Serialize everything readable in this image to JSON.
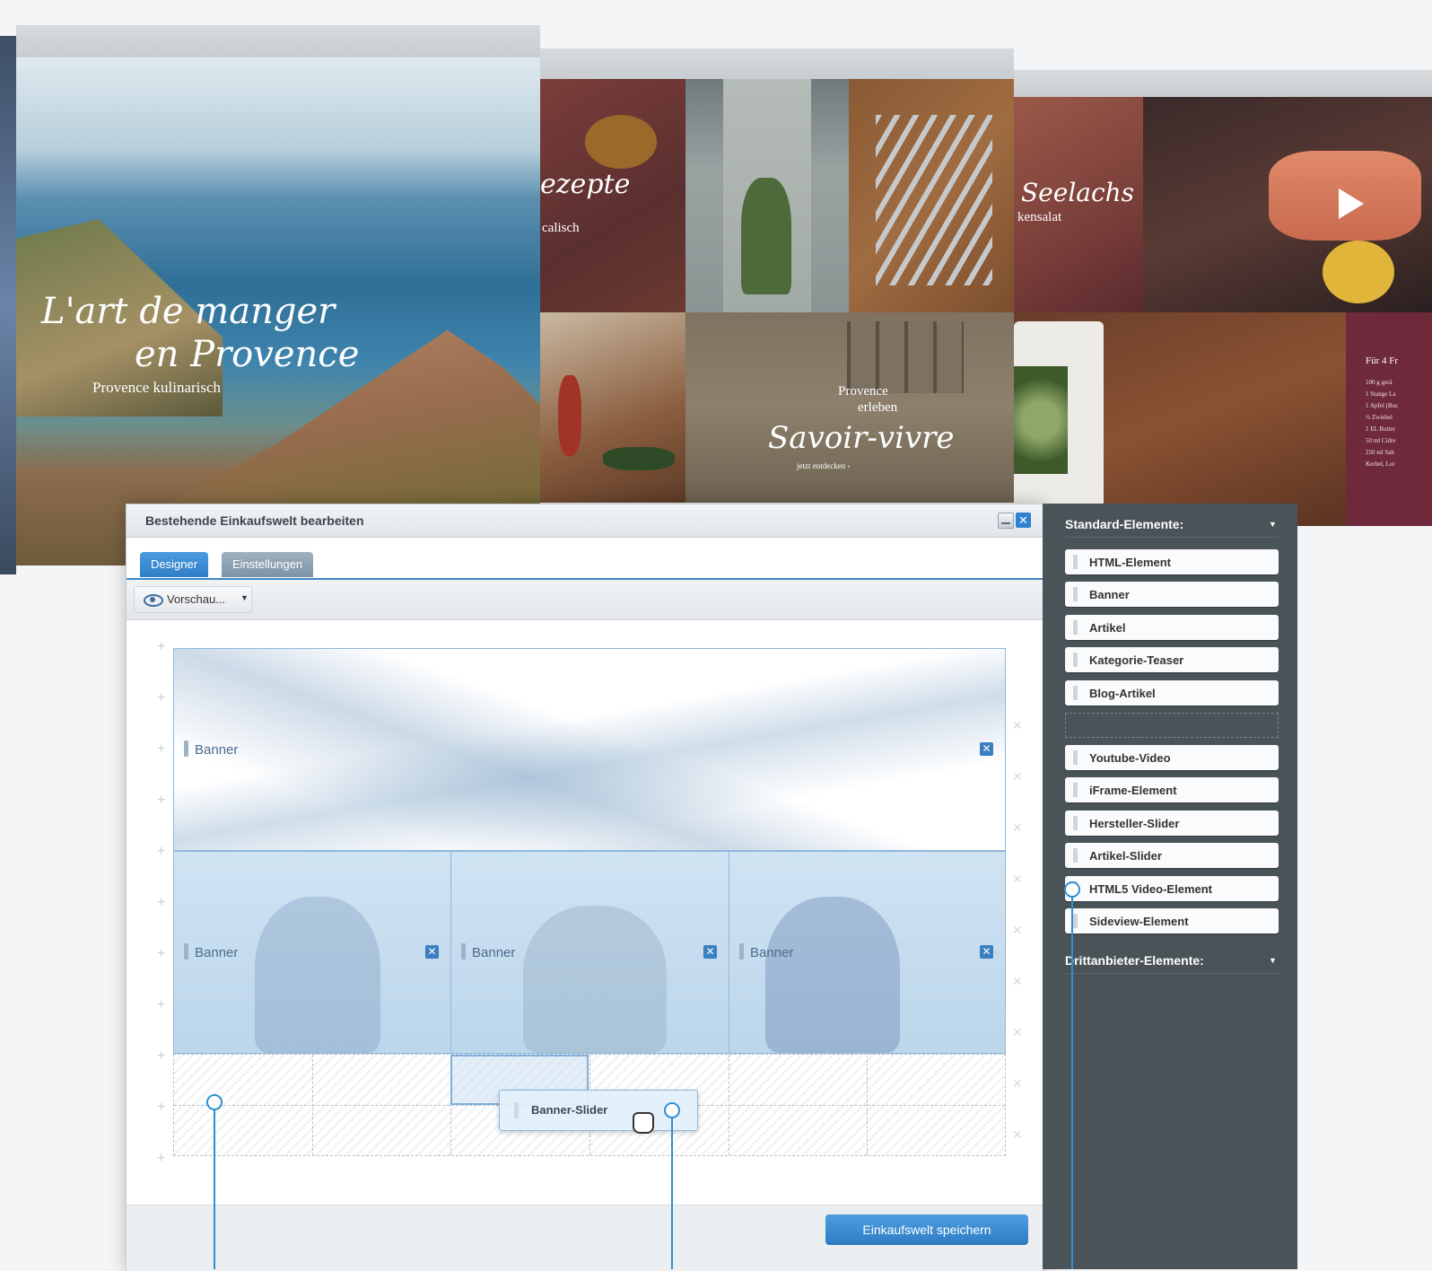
{
  "previews": {
    "provence": {
      "title_line1": "L'art de manger",
      "title_line2": "en Provence",
      "subtitle": "Provence kulinarisch"
    },
    "tiles": {
      "rezepte": "ezepte",
      "rezepte_sub": "calisch",
      "provence_erleben_1": "Provence",
      "provence_erleben_2": "erleben",
      "savoir_vivre": "Savoir-vivre",
      "jetzt_entdecken": "jetzt entdecken ›"
    },
    "seelachs": {
      "title": "Seelachs",
      "subtitle": "kensalat",
      "recipe_head": "Für 4 Fr",
      "recipe_lines": [
        "100 g gerä",
        "1 Stange La",
        "1 Apfel (Bos",
        "½ Zwiebel",
        "1 EL Butter",
        "50 ml Cidre",
        "250 ml Sah",
        "Kerbel, Lor"
      ]
    }
  },
  "dialog": {
    "title": "Bestehende Einkaufswelt bearbeiten",
    "tabs": [
      "Designer",
      "Einstellungen"
    ],
    "preview_button": "Vorschau...",
    "banners": {
      "top": "Banner",
      "left": "Banner",
      "middle": "Banner",
      "right": "Banner"
    },
    "dragging_item": "Banner-Slider",
    "save_button": "Einkaufswelt speichern"
  },
  "palette": {
    "standard_header": "Standard-Elemente:",
    "standard_items": [
      "HTML-Element",
      "Banner",
      "Artikel",
      "Kategorie-Teaser",
      "Blog-Artikel"
    ],
    "extra_items": [
      "Youtube-Video",
      "iFrame-Element",
      "Hersteller-Slider",
      "Artikel-Slider",
      "HTML5 Video-Element",
      "Sideview-Element"
    ],
    "third_party_header": "Drittanbieter-Elemente:"
  },
  "colors": {
    "accent": "#3a87c8",
    "palette_bg": "#4a5358",
    "callout": "#2f8fd0"
  }
}
